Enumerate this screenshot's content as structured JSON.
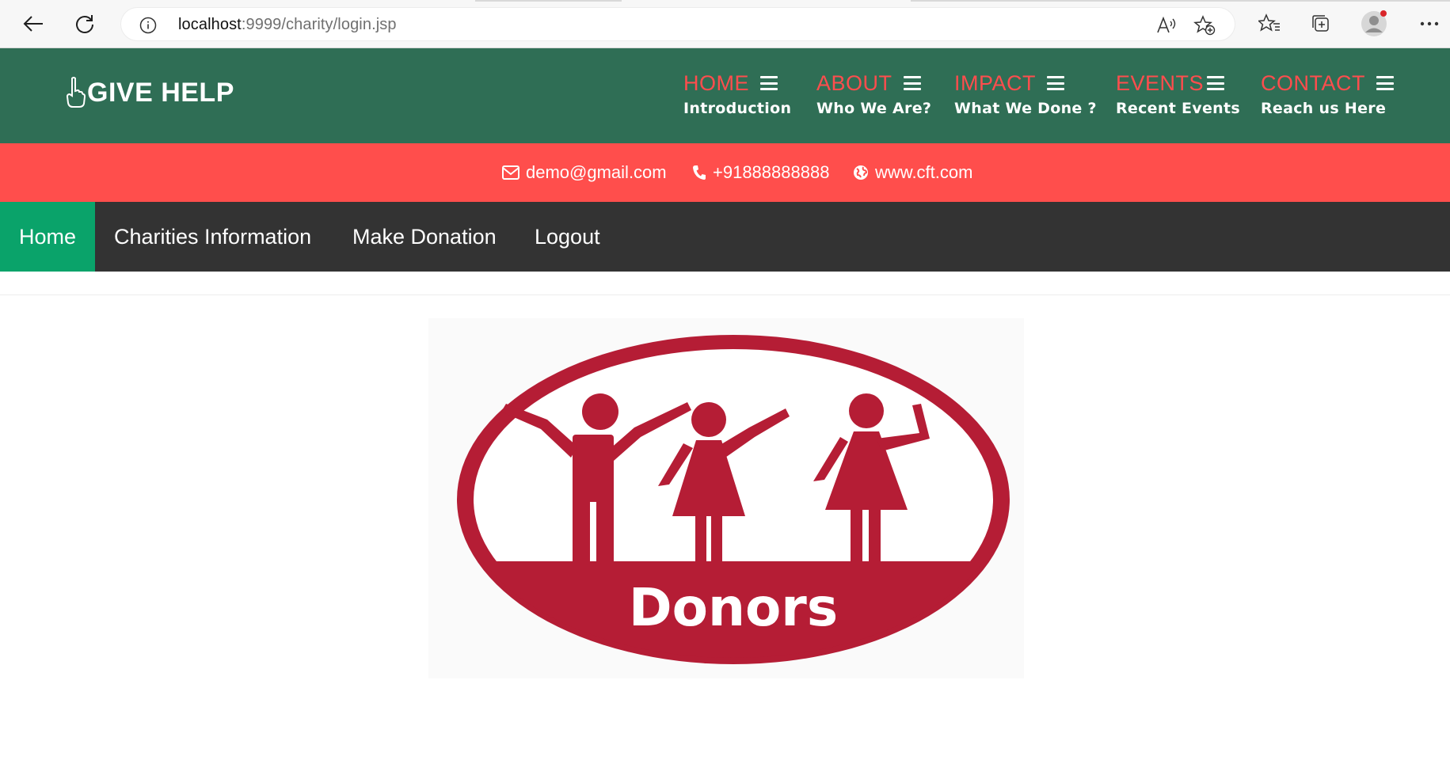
{
  "browser": {
    "url_host": "localhost",
    "url_rest": ":9999/charity/login.jsp",
    "icons": [
      "back-arrow-icon",
      "refresh-icon",
      "info-icon",
      "read-aloud-icon",
      "add-favorite-icon",
      "favorites-icon",
      "collections-icon",
      "profile-avatar",
      "more-icon"
    ]
  },
  "brand": {
    "name": "GIVE HELP",
    "icon": "pointing-hand-icon"
  },
  "main_nav": [
    {
      "title": "HOME",
      "subtitle": "Introduction"
    },
    {
      "title": "ABOUT",
      "subtitle": "Who We Are?"
    },
    {
      "title": "IMPACT",
      "subtitle": "What We Done ?"
    },
    {
      "title": "EVENTS",
      "subtitle": "Recent Events"
    },
    {
      "title": "CONTACT",
      "subtitle": "Reach us Here"
    }
  ],
  "contact": {
    "email": "demo@gmail.com",
    "phone": "+91888888888",
    "website": "www.cft.com"
  },
  "secondary_nav": [
    {
      "label": "Home",
      "active": true
    },
    {
      "label": "Charities Information",
      "active": false
    },
    {
      "label": "Make Donation",
      "active": false
    },
    {
      "label": "Logout",
      "active": false
    }
  ],
  "hero": {
    "caption": "Donors"
  },
  "colors": {
    "header_green": "#2f6e55",
    "nav_title_red": "#ff4d4d",
    "contact_strip": "#ff4e4c",
    "secondary_nav": "#333333",
    "active_green": "#0aa36a",
    "donors_red": "#b51d35"
  }
}
